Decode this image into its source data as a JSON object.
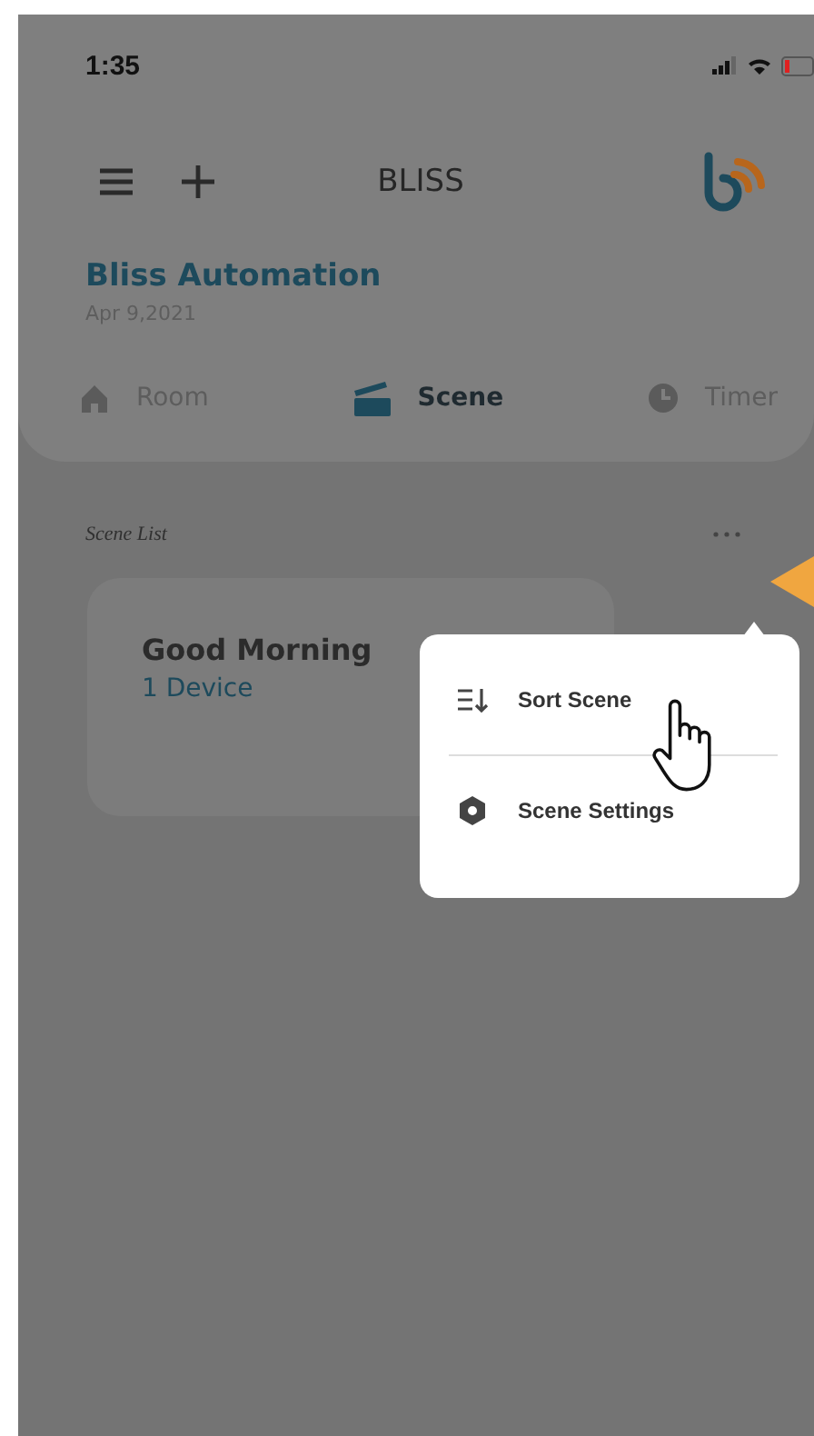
{
  "status_bar": {
    "time": "1:35"
  },
  "toolbar": {
    "title": "BLISS"
  },
  "home": {
    "name": "Bliss Automation",
    "date": "Apr 9,2021"
  },
  "tabs": [
    {
      "label": "Room",
      "kind": "room",
      "selected": false
    },
    {
      "label": "Scene",
      "kind": "scene",
      "selected": true
    },
    {
      "label": "Timer",
      "kind": "timer",
      "selected": false
    }
  ],
  "section": {
    "label": "Scene List"
  },
  "scenes": [
    {
      "name": "Good Morning",
      "devices": "1 Device"
    }
  ],
  "menu": {
    "items": [
      {
        "label": "Sort Scene",
        "kind": "sort"
      },
      {
        "label": "Scene Settings",
        "kind": "settings"
      }
    ]
  }
}
